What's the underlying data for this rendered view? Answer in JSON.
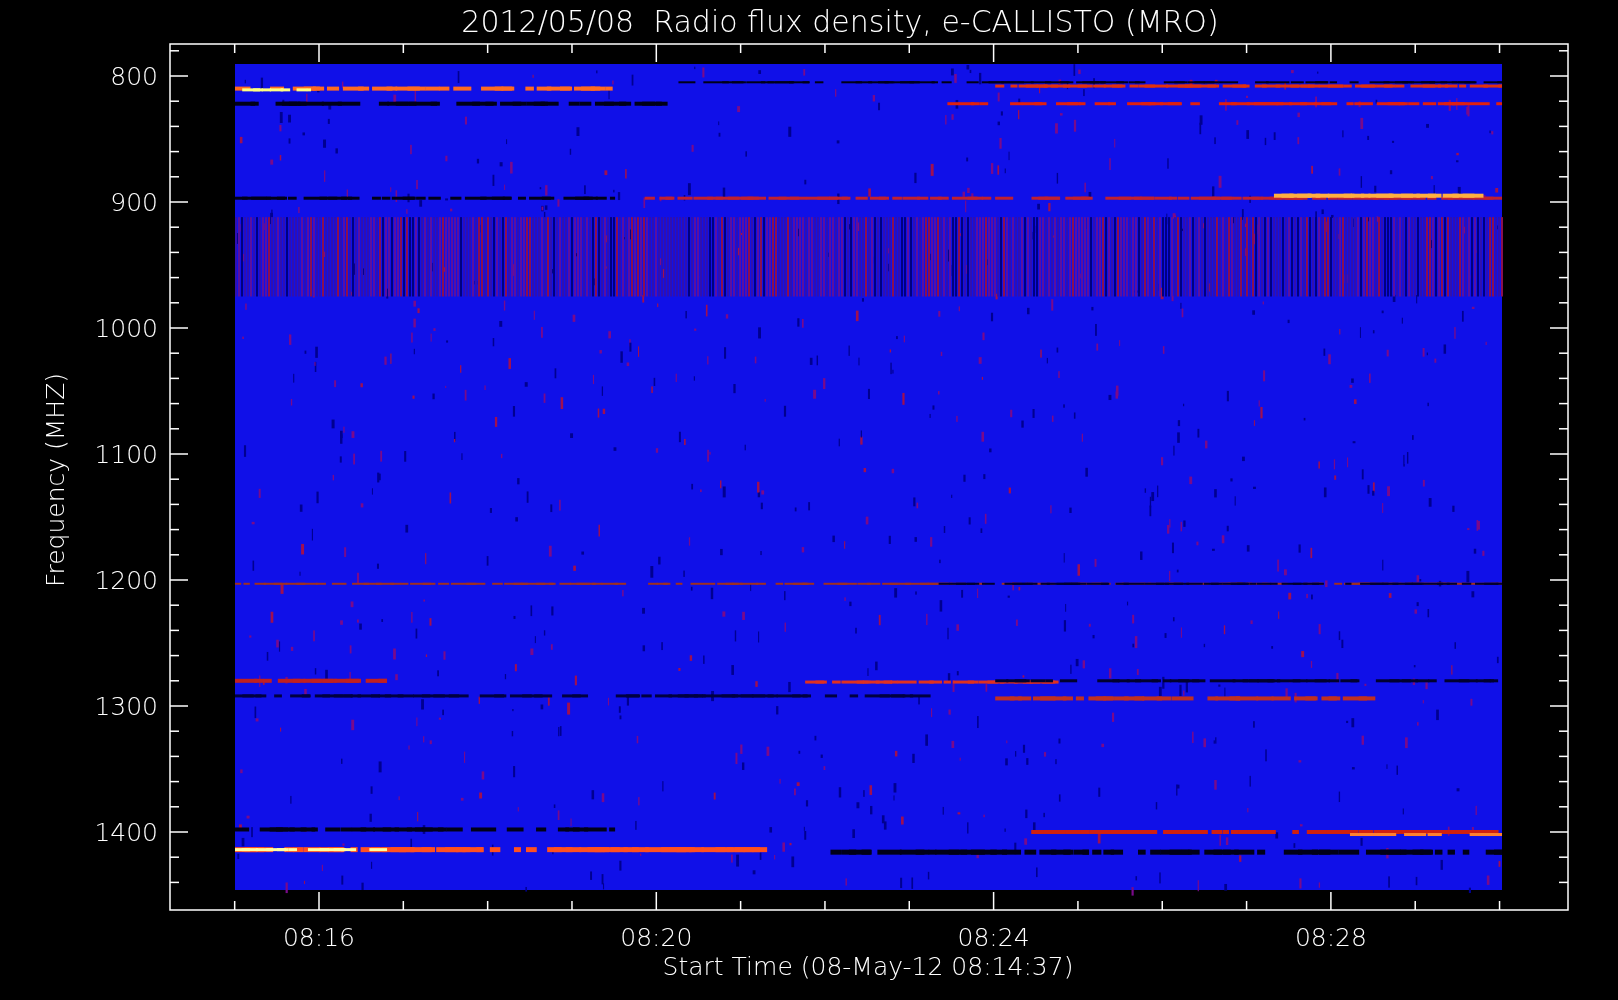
{
  "title": "2012/05/08  Radio flux density, e-CALLISTO (MRO)",
  "y_axis": {
    "label": "Frequency (MHZ)",
    "ticks": [
      "800",
      "900",
      "1000",
      "1100",
      "1200",
      "1300",
      "1400"
    ]
  },
  "x_axis": {
    "label": "Start Time (08-May-12 08:14:37)",
    "ticks": [
      "08:16",
      "08:20",
      "08:24",
      "08:28"
    ]
  }
}
